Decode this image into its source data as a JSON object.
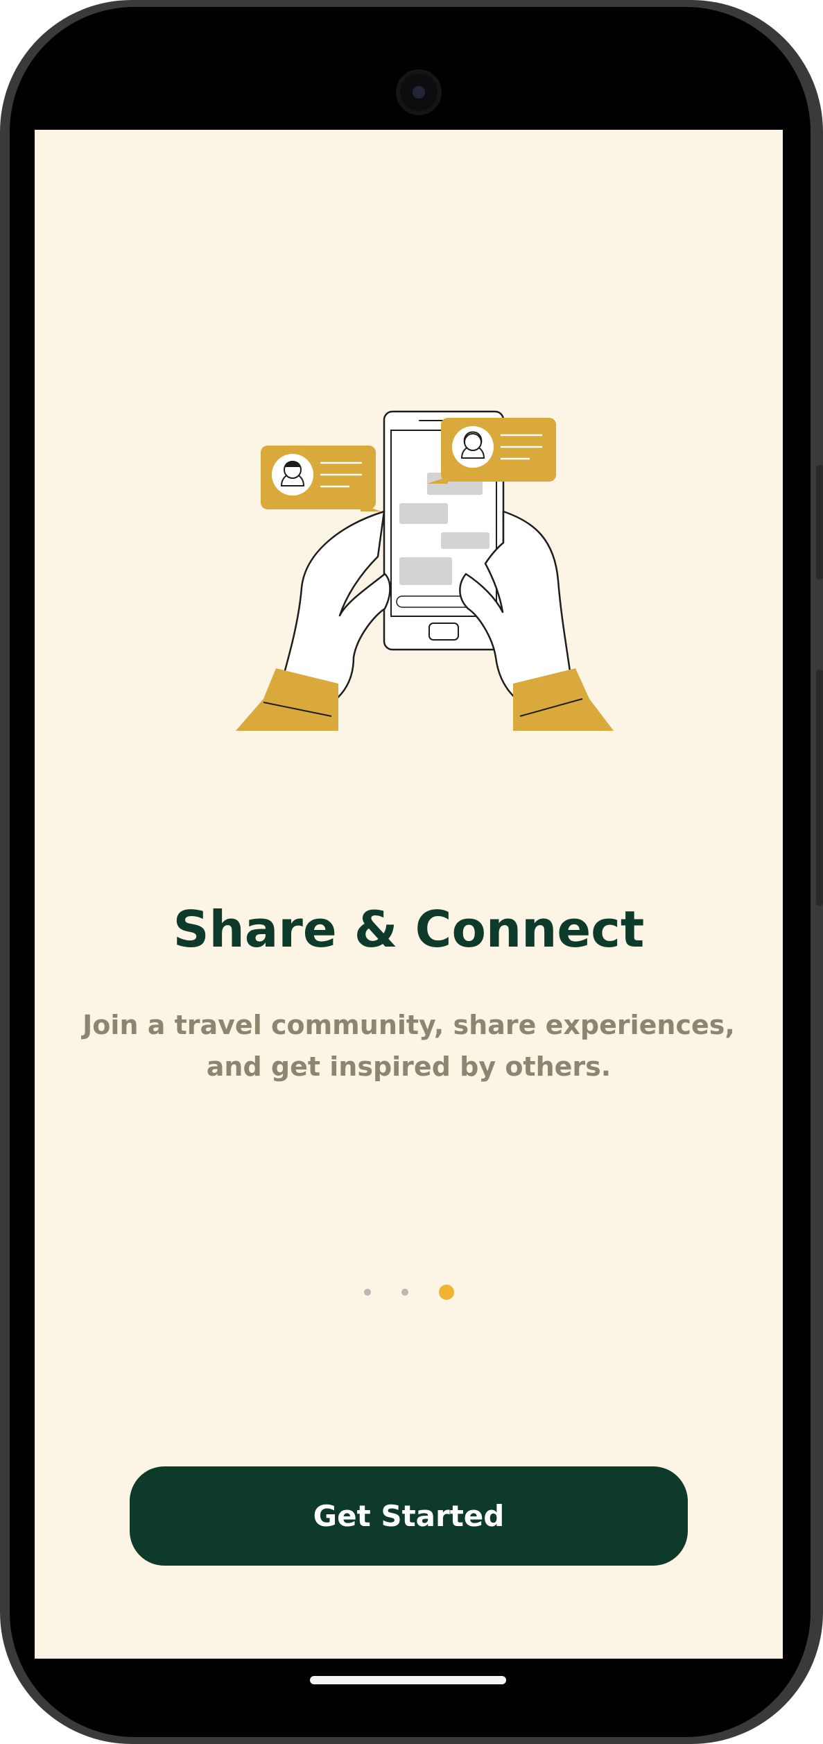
{
  "onboarding": {
    "title": "Share & Connect",
    "subtitle": "Join a travel community, share experiences, and get inspired by others.",
    "illustration_icon": "phone-chat-hands-illustration",
    "pager": {
      "total": 3,
      "active_index": 2
    },
    "cta_label": "Get Started"
  },
  "colors": {
    "background": "#fcf4e4",
    "title": "#0e3a2c",
    "subtitle": "#8c8670",
    "button": "#0e3a2c",
    "button_text": "#ffffff",
    "accent": "#d9a93c",
    "active_dot": "#f1b332",
    "inactive_dot": "#b9b9b4"
  }
}
